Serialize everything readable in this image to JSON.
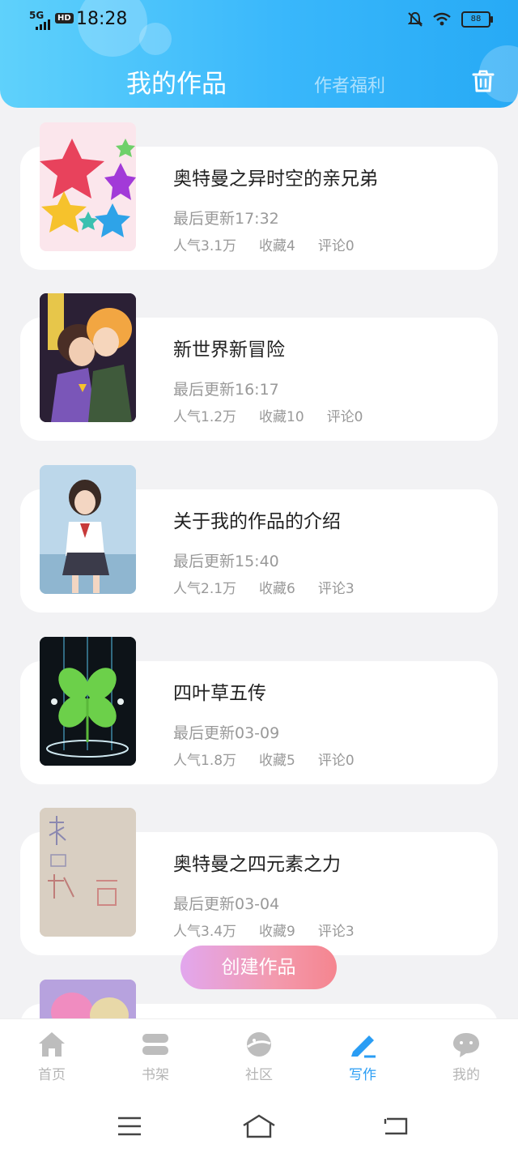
{
  "status_bar": {
    "network": "5G",
    "hd": "HD",
    "time": "18:28",
    "battery": "88"
  },
  "header": {
    "tab_active": "我的作品",
    "tab_inactive": "作者福利"
  },
  "works": [
    {
      "title": "奥特曼之异时空的亲兄弟",
      "updated": "最后更新17:32",
      "popularity": "人气3.1万",
      "favorites": "收藏4",
      "comments": "评论0"
    },
    {
      "title": "新世界新冒险",
      "updated": "最后更新16:17",
      "popularity": "人气1.2万",
      "favorites": "收藏10",
      "comments": "评论0"
    },
    {
      "title": "关于我的作品的介绍",
      "updated": "最后更新15:40",
      "popularity": "人气2.1万",
      "favorites": "收藏6",
      "comments": "评论3"
    },
    {
      "title": "四叶草五传",
      "updated": "最后更新03-09",
      "popularity": "人气1.8万",
      "favorites": "收藏5",
      "comments": "评论0"
    },
    {
      "title": "奥特曼之四元素之力",
      "updated": "最后更新03-04",
      "popularity": "人气3.4万",
      "favorites": "收藏9",
      "comments": "评论3"
    }
  ],
  "create_button": "创建作品",
  "bottom_nav": [
    {
      "label": "首页",
      "icon": "home-icon"
    },
    {
      "label": "书架",
      "icon": "bookshelf-icon"
    },
    {
      "label": "社区",
      "icon": "community-icon"
    },
    {
      "label": "写作",
      "icon": "write-icon",
      "active": true
    },
    {
      "label": "我的",
      "icon": "profile-icon"
    }
  ],
  "colors": {
    "accent": "#2a9df4",
    "header_start": "#5fd1fb",
    "header_end": "#27aaf5",
    "create_start": "#e2a7ee",
    "create_end": "#f5858f"
  }
}
